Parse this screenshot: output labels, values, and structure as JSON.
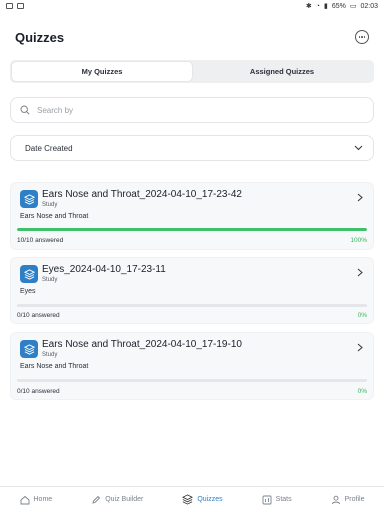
{
  "status_bar": {
    "battery": "65%",
    "time": "02:03"
  },
  "header": {
    "title": "Quizzes"
  },
  "tabs": [
    {
      "label": "My Quizzes",
      "active": true
    },
    {
      "label": "Assigned Quizzes",
      "active": false
    }
  ],
  "search": {
    "placeholder": "Search by"
  },
  "sort": {
    "value": "Date Created"
  },
  "quizzes": [
    {
      "title": "Ears Nose and Throat_2024-04-10_17-23-42",
      "type": "Study",
      "description": "Ears Nose and Throat",
      "answered": "10/10 answered",
      "percent": "100%",
      "progress": 1.0
    },
    {
      "title": "Eyes_2024-04-10_17-23-11",
      "type": "Study",
      "description": "Eyes",
      "answered": "0/10 answered",
      "percent": "0%",
      "progress": 0.0
    },
    {
      "title": "Ears Nose and Throat_2024-04-10_17-19-10",
      "type": "Study",
      "description": "Ears Nose and Throat",
      "answered": "0/10 answered",
      "percent": "0%",
      "progress": 0.0
    }
  ],
  "nav": [
    {
      "label": "Home",
      "icon": "home-icon",
      "active": false
    },
    {
      "label": "Quiz Builder",
      "icon": "pencil-icon",
      "active": false
    },
    {
      "label": "Quizzes",
      "icon": "layers-icon",
      "active": true
    },
    {
      "label": "Stats",
      "icon": "stats-icon",
      "active": false
    },
    {
      "label": "Profile",
      "icon": "profile-icon",
      "active": false
    }
  ],
  "colors": {
    "accent": "#2f7fc6",
    "progress": "#3cc06a",
    "percent_text": "#3cb364"
  }
}
